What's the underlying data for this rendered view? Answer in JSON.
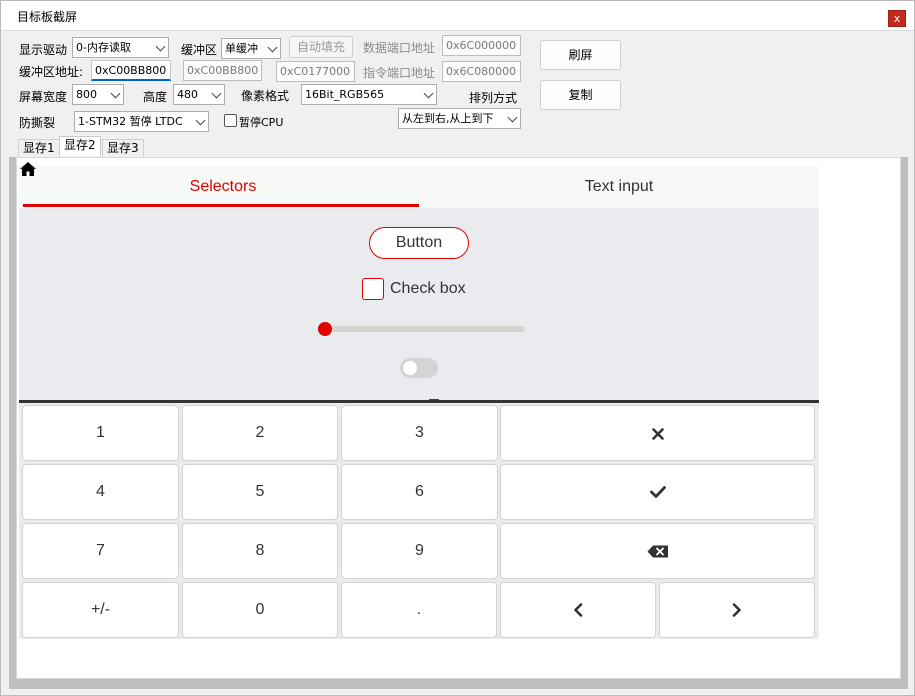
{
  "window": {
    "title": "目标板截屏",
    "close": "x"
  },
  "controls": {
    "driver_label": "显示驱动",
    "driver_value": "0-内存读取",
    "buffer_label": "缓冲区",
    "buffer_value": "单缓冲",
    "autofill": "自动填充",
    "data_port_label": "数据端口地址",
    "data_port_value": "0x6C000000",
    "cmd_port_label": "指令端口地址",
    "cmd_port_value": "0x6C080000",
    "buf_addr_label": "缓冲区地址:",
    "buf_addr_value": "0xC00BB800",
    "buf_addr2": "0xC00BB800",
    "buf_addr3": "0xC0177000",
    "width_label": "屏幕宽度",
    "width_value": "800",
    "height_label": "高度",
    "height_value": "480",
    "pixel_label": "像素格式",
    "pixel_value": "16Bit_RGB565",
    "order_label": "排列方式",
    "order_value": "从左到右,从上到下",
    "tear_label": "防撕裂",
    "tear_value": "1-STM32 暂停 LTDC",
    "pause_cpu": "暂停CPU",
    "refresh": "刷屏",
    "copy": "复制"
  },
  "tabs": [
    "显存1",
    "显存2",
    "显存3"
  ],
  "screen": {
    "tabs": [
      "Selectors",
      "Text input"
    ],
    "button": "Button",
    "checkbox": "Check box",
    "slider_value": 0,
    "switch_on": false
  },
  "keyboard": {
    "rows": [
      [
        "1",
        "2",
        "3"
      ],
      [
        "4",
        "5",
        "6"
      ],
      [
        "7",
        "8",
        "9"
      ],
      [
        "+/-",
        "0",
        "."
      ]
    ],
    "icons": [
      "close-icon",
      "ok-icon",
      "backspace-icon",
      "left-icon",
      "right-icon"
    ]
  },
  "colors": {
    "accent": "#e00000",
    "close": "#c42b1c"
  }
}
